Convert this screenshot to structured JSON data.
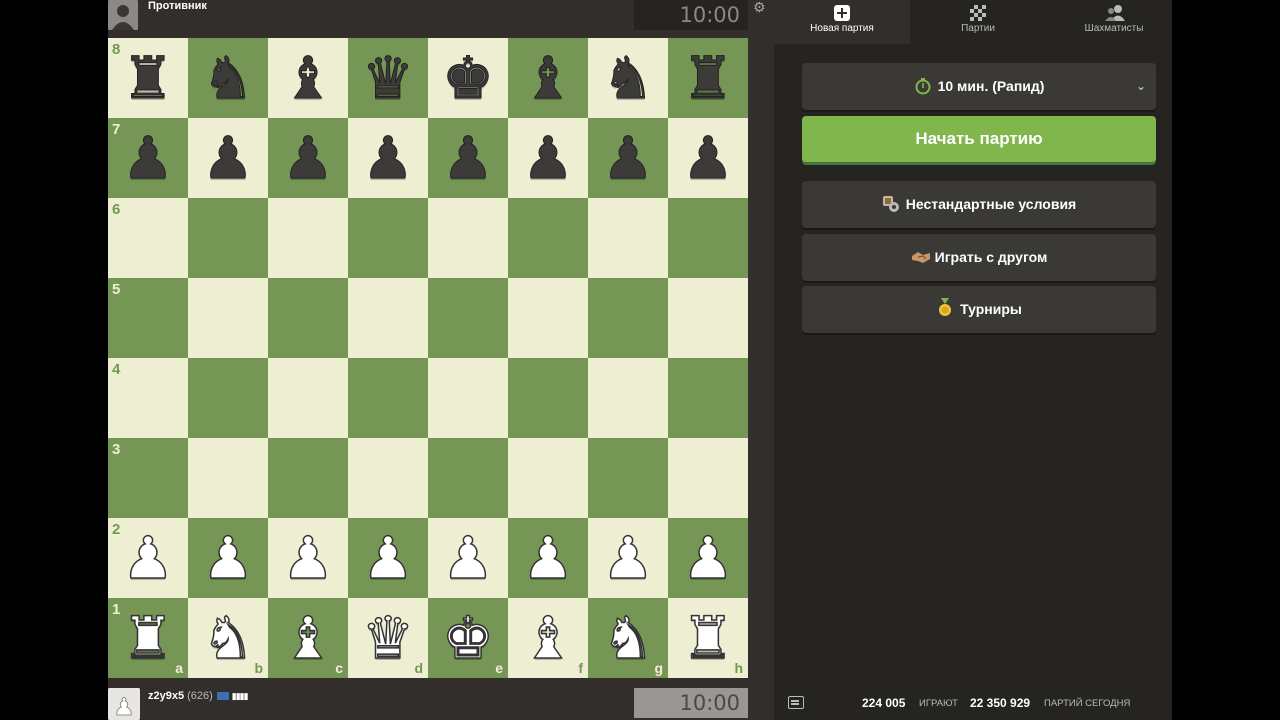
{
  "colors": {
    "light_square": "#eeeed2",
    "dark_square": "#769656",
    "start_button": "#81b64c",
    "panel_bg": "#262421"
  },
  "top_player": {
    "name": "Противник",
    "clock": "10:00"
  },
  "bottom_player": {
    "name": "z2y9x5",
    "rating": "(626)",
    "clock": "10:00"
  },
  "board": {
    "ranks": [
      "8",
      "7",
      "6",
      "5",
      "4",
      "3",
      "2",
      "1"
    ],
    "files": [
      "a",
      "b",
      "c",
      "d",
      "e",
      "f",
      "g",
      "h"
    ],
    "position": [
      [
        "br",
        "bn",
        "bb",
        "bq",
        "bk",
        "bb",
        "bn",
        "br"
      ],
      [
        "bp",
        "bp",
        "bp",
        "bp",
        "bp",
        "bp",
        "bp",
        "bp"
      ],
      [
        "",
        "",
        "",
        "",
        "",
        "",
        "",
        ""
      ],
      [
        "",
        "",
        "",
        "",
        "",
        "",
        "",
        ""
      ],
      [
        "",
        "",
        "",
        "",
        "",
        "",
        "",
        ""
      ],
      [
        "",
        "",
        "",
        "",
        "",
        "",
        "",
        ""
      ],
      [
        "wp",
        "wp",
        "wp",
        "wp",
        "wp",
        "wp",
        "wp",
        "wp"
      ],
      [
        "wr",
        "wn",
        "wb",
        "wq",
        "wk",
        "wb",
        "wn",
        "wr"
      ]
    ]
  },
  "tabs": [
    {
      "label": "Новая партия",
      "icon": "plus-square-icon",
      "active": true
    },
    {
      "label": "Партии",
      "icon": "board-icon",
      "active": false
    },
    {
      "label": "Шахматисты",
      "icon": "users-icon",
      "active": false
    }
  ],
  "time_control": {
    "label": "10 мин. (Рапид)",
    "icon": "stopwatch-icon"
  },
  "start_button": {
    "label": "Начать партию"
  },
  "menu": {
    "custom": {
      "label": "Нестандартные условия",
      "icon": "custom-settings-icon"
    },
    "friend": {
      "label": "Играть с другом",
      "icon": "handshake-icon"
    },
    "tournaments": {
      "label": "Турниры",
      "icon": "medal-icon"
    }
  },
  "footer": {
    "playing_count": "224 005",
    "playing_label": "ИГРАЮТ",
    "games_count": "22 350 929",
    "games_label": "ПАРТИЙ СЕГОДНЯ"
  }
}
